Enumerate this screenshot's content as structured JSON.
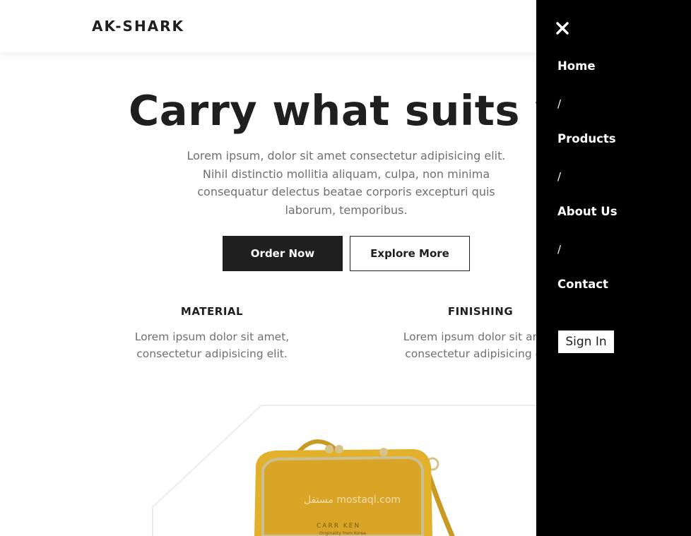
{
  "header": {
    "logo": "AK-SHARK"
  },
  "hero": {
    "title": "Carry what suits you",
    "description": "Lorem ipsum, dolor sit amet consectetur adipisicing elit. Nihil distinctio mollitia aliquam, culpa, non minima consequatur delectus beatae corporis excepturi quis laborum, temporibus.",
    "order_label": "Order Now",
    "explore_label": "Explore More"
  },
  "features": [
    {
      "title": "MATERIAL",
      "description": "Lorem ipsum dolor sit amet, consectetur adipisicing elit."
    },
    {
      "title": "FINISHING",
      "description": "Lorem ipsum dolor sit amet, consectetur adipisicing elit."
    }
  ],
  "product": {
    "watermark": "مستقل mostaql.com",
    "brand": "CARR KEN",
    "tagline": "Originality from Korea",
    "colors": {
      "bag": "#e3b02c",
      "bag_dark": "#b9871a",
      "metal": "#d6c28a"
    }
  },
  "sidebar": {
    "close_icon": "close-icon",
    "items": [
      {
        "label": "Home"
      },
      {
        "label": "Products"
      },
      {
        "label": "About Us"
      },
      {
        "label": "Contact"
      }
    ],
    "separator": "/",
    "signin_label": "Sign In"
  }
}
